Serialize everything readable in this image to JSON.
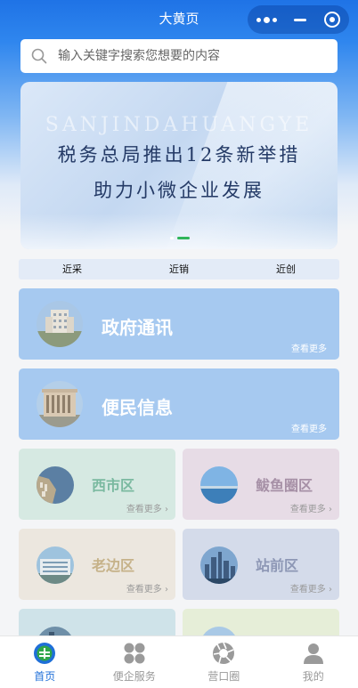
{
  "header": {
    "title": "大黄页"
  },
  "search": {
    "placeholder": "输入关键字搜索您想要的内容"
  },
  "banner": {
    "watermark": "SANJINDAHUANGYE",
    "line1": "税务总局推出12条新举措",
    "line2": "助力小微企业发展",
    "slide_count": 2,
    "active_slide": 2
  },
  "tabs": [
    "近采",
    "近销",
    "近创"
  ],
  "featured": [
    {
      "label": "政府通讯",
      "more": "查看更多"
    },
    {
      "label": "便民信息",
      "more": "查看更多"
    }
  ],
  "districts": [
    {
      "label": "西市区",
      "more": "查看更多",
      "bg": "#d6e9e2",
      "color": "#7ab9a0"
    },
    {
      "label": "鲅鱼圈区",
      "more": "查看更多",
      "bg": "#e7dce6",
      "color": "#a690a6"
    },
    {
      "label": "老边区",
      "more": "查看更多",
      "bg": "#ece7df",
      "color": "#c6b289"
    },
    {
      "label": "站前区",
      "more": "查看更多",
      "bg": "#d4dbea",
      "color": "#8d97b5"
    }
  ],
  "partial_cards": [
    {
      "bg": "#cfe3e9"
    },
    {
      "bg": "#e6eed8"
    }
  ],
  "bottom_nav": [
    {
      "label": "首页",
      "icon": "home-logo-icon",
      "active": true
    },
    {
      "label": "便企服务",
      "icon": "grid-icon",
      "active": false
    },
    {
      "label": "营口圈",
      "icon": "aperture-icon",
      "active": false
    },
    {
      "label": "我的",
      "icon": "user-icon",
      "active": false
    }
  ],
  "colors": {
    "primary": "#1f73e6",
    "card_blue": "#a6c9f0",
    "active_nav": "#1f6fd8",
    "inactive_nav": "#999999"
  }
}
